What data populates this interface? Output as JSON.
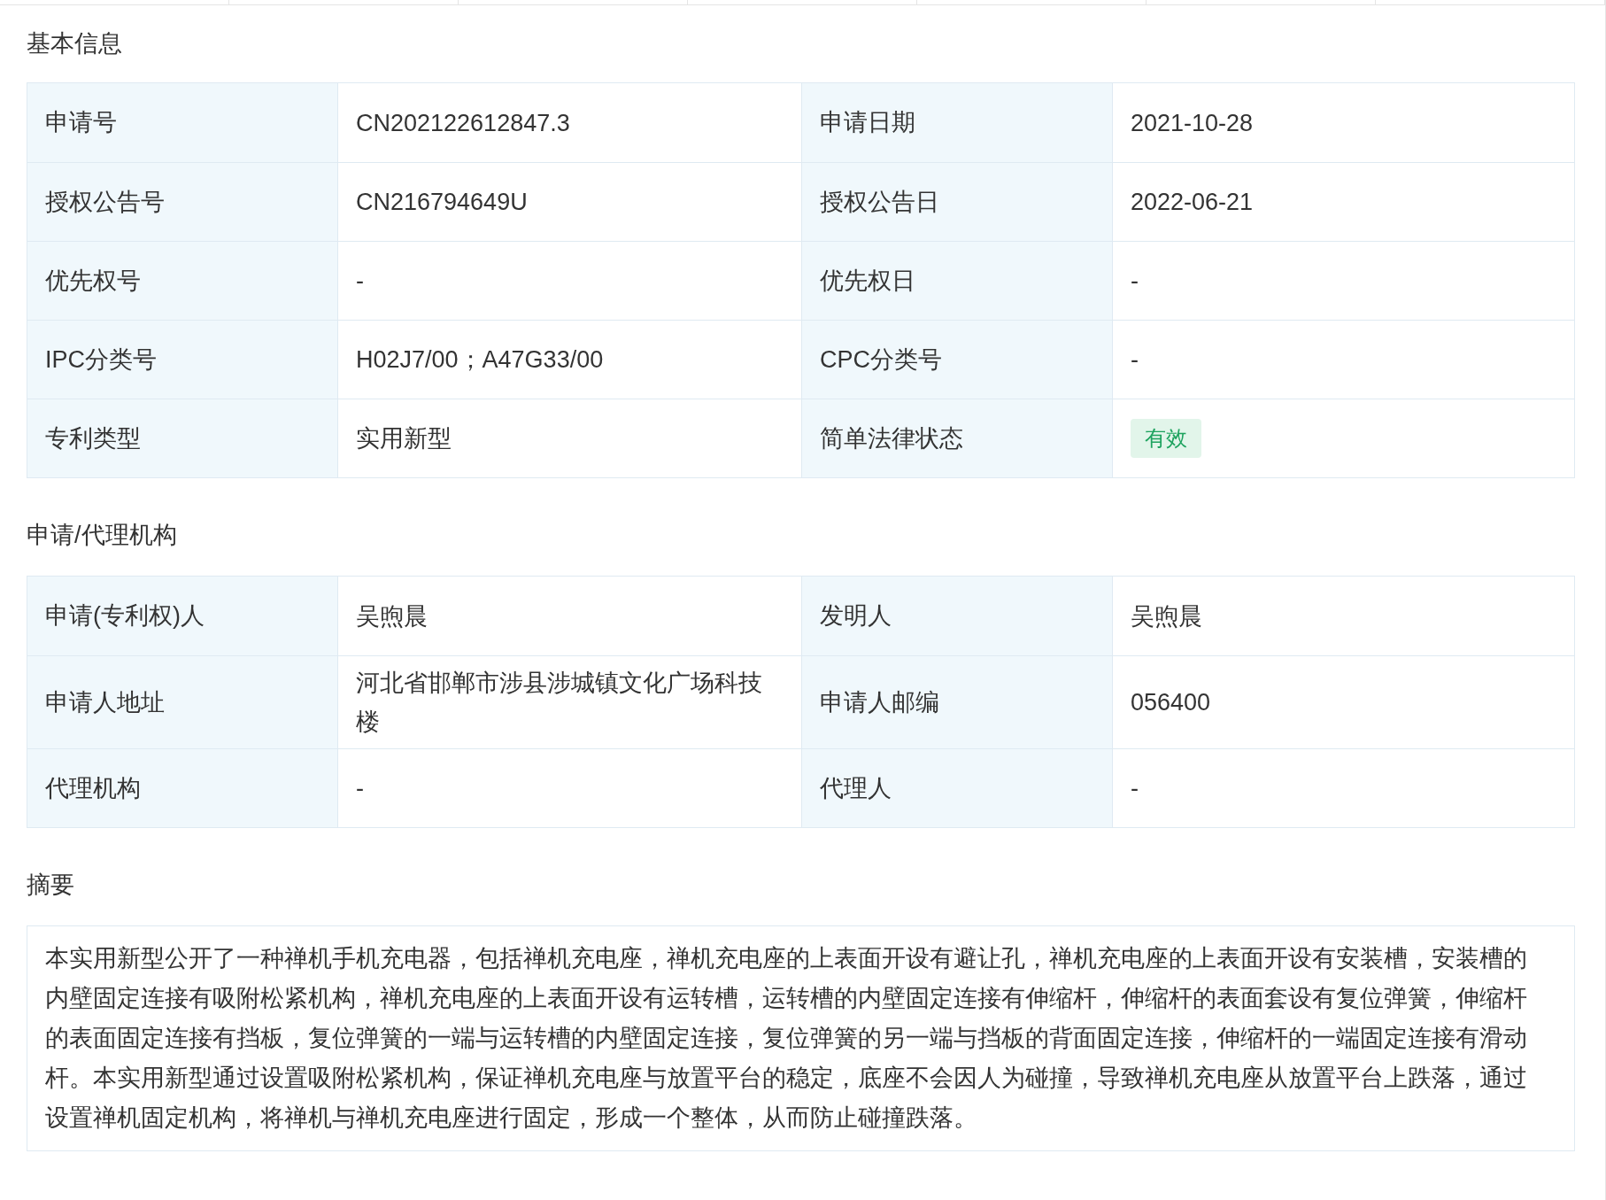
{
  "sections": [
    {
      "title": "基本信息",
      "rows": [
        [
          {
            "label": "申请号",
            "value": "CN202122612847.3",
            "kind": "text"
          },
          {
            "label": "申请日期",
            "value": "2021-10-28",
            "kind": "text"
          }
        ],
        [
          {
            "label": "授权公告号",
            "value": "CN216794649U",
            "kind": "text"
          },
          {
            "label": "授权公告日",
            "value": "2022-06-21",
            "kind": "text"
          }
        ],
        [
          {
            "label": "优先权号",
            "value": "-",
            "kind": "text"
          },
          {
            "label": "优先权日",
            "value": "-",
            "kind": "text"
          }
        ],
        [
          {
            "label": "IPC分类号",
            "value": "H02J7/00；A47G33/00",
            "kind": "text"
          },
          {
            "label": "CPC分类号",
            "value": "-",
            "kind": "text"
          }
        ],
        [
          {
            "label": "专利类型",
            "value": "实用新型",
            "kind": "text"
          },
          {
            "label": "简单法律状态",
            "value": "有效",
            "kind": "tag"
          }
        ]
      ]
    },
    {
      "title": "申请/代理机构",
      "rows": [
        [
          {
            "label": "申请(专利权)人",
            "value": "吴煦晨",
            "kind": "text"
          },
          {
            "label": "发明人",
            "value": "吴煦晨",
            "kind": "text"
          }
        ],
        [
          {
            "label": "申请人地址",
            "value": "河北省邯郸市涉县涉城镇文化广场科技楼",
            "kind": "text"
          },
          {
            "label": "申请人邮编",
            "value": "056400",
            "kind": "text"
          }
        ],
        [
          {
            "label": "代理机构",
            "value": "-",
            "kind": "text"
          },
          {
            "label": "代理人",
            "value": "-",
            "kind": "text"
          }
        ]
      ]
    }
  ],
  "abstract": {
    "title": "摘要",
    "text": "本实用新型公开了一种禅机手机充电器，包括禅机充电座，禅机充电座的上表面开设有避让孔，禅机充电座的上表面开设有安装槽，安装槽的内壁固定连接有吸附松紧机构，禅机充电座的上表面开设有运转槽，运转槽的内壁固定连接有伸缩杆，伸缩杆的表面套设有复位弹簧，伸缩杆的表面固定连接有挡板，复位弹簧的一端与运转槽的内壁固定连接，复位弹簧的另一端与挡板的背面固定连接，伸缩杆的一端固定连接有滑动杆。本实用新型通过设置吸附松紧机构，保证禅机充电座与放置平台的稳定，底座不会因人为碰撞，导致禅机充电座从放置平台上跌落，通过设置禅机固定机构，将禅机与禅机充电座进行固定，形成一个整体，从而防止碰撞跌落。"
  }
}
